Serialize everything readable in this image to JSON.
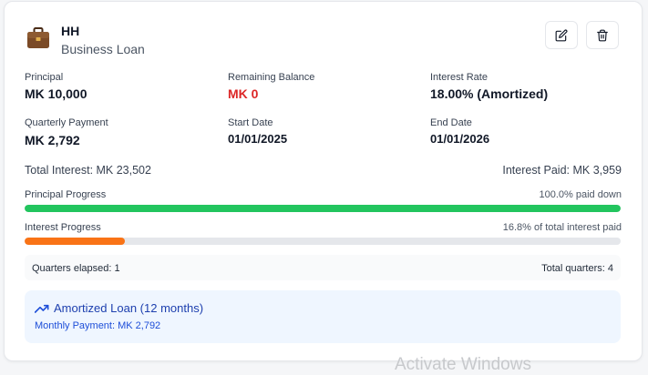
{
  "header": {
    "title": "HH",
    "subtitle": "Business Loan",
    "briefcase_icon": "briefcase-icon",
    "edit_icon": "pencil-square-icon",
    "delete_icon": "trash-icon"
  },
  "details": {
    "principal_label": "Principal",
    "principal_value": "MK 10,000",
    "remaining_label": "Remaining Balance",
    "remaining_value": "MK 0",
    "rate_label": "Interest Rate",
    "rate_value": "18.00% (Amortized)",
    "payment_label": "Quarterly Payment",
    "payment_value": "MK 2,792",
    "start_label": "Start Date",
    "start_value": "01/01/2025",
    "end_label": "End Date",
    "end_value": "01/01/2026"
  },
  "totals": {
    "total_interest": "Total Interest: MK 23,502",
    "interest_paid": "Interest Paid: MK 3,959"
  },
  "principal_progress": {
    "label": "Principal Progress",
    "status": "100.0% paid down",
    "percent": 100
  },
  "interest_progress": {
    "label": "Interest Progress",
    "status": "16.8% of total interest paid",
    "percent": 16.8
  },
  "quarters": {
    "elapsed": "Quarters elapsed: 1",
    "total": "Total quarters: 4"
  },
  "amortized": {
    "title": "Amortized Loan (12 months)",
    "monthly": "Monthly Payment: MK 2,792",
    "icon": "trending-up-icon"
  },
  "colors": {
    "principal_bar": "#22c55e",
    "interest_bar": "#f97316",
    "remaining_value": "#dc2626",
    "amortized_text": "#1e40af",
    "amortized_bg": "#eff6ff"
  },
  "watermark": "Activate Windows"
}
